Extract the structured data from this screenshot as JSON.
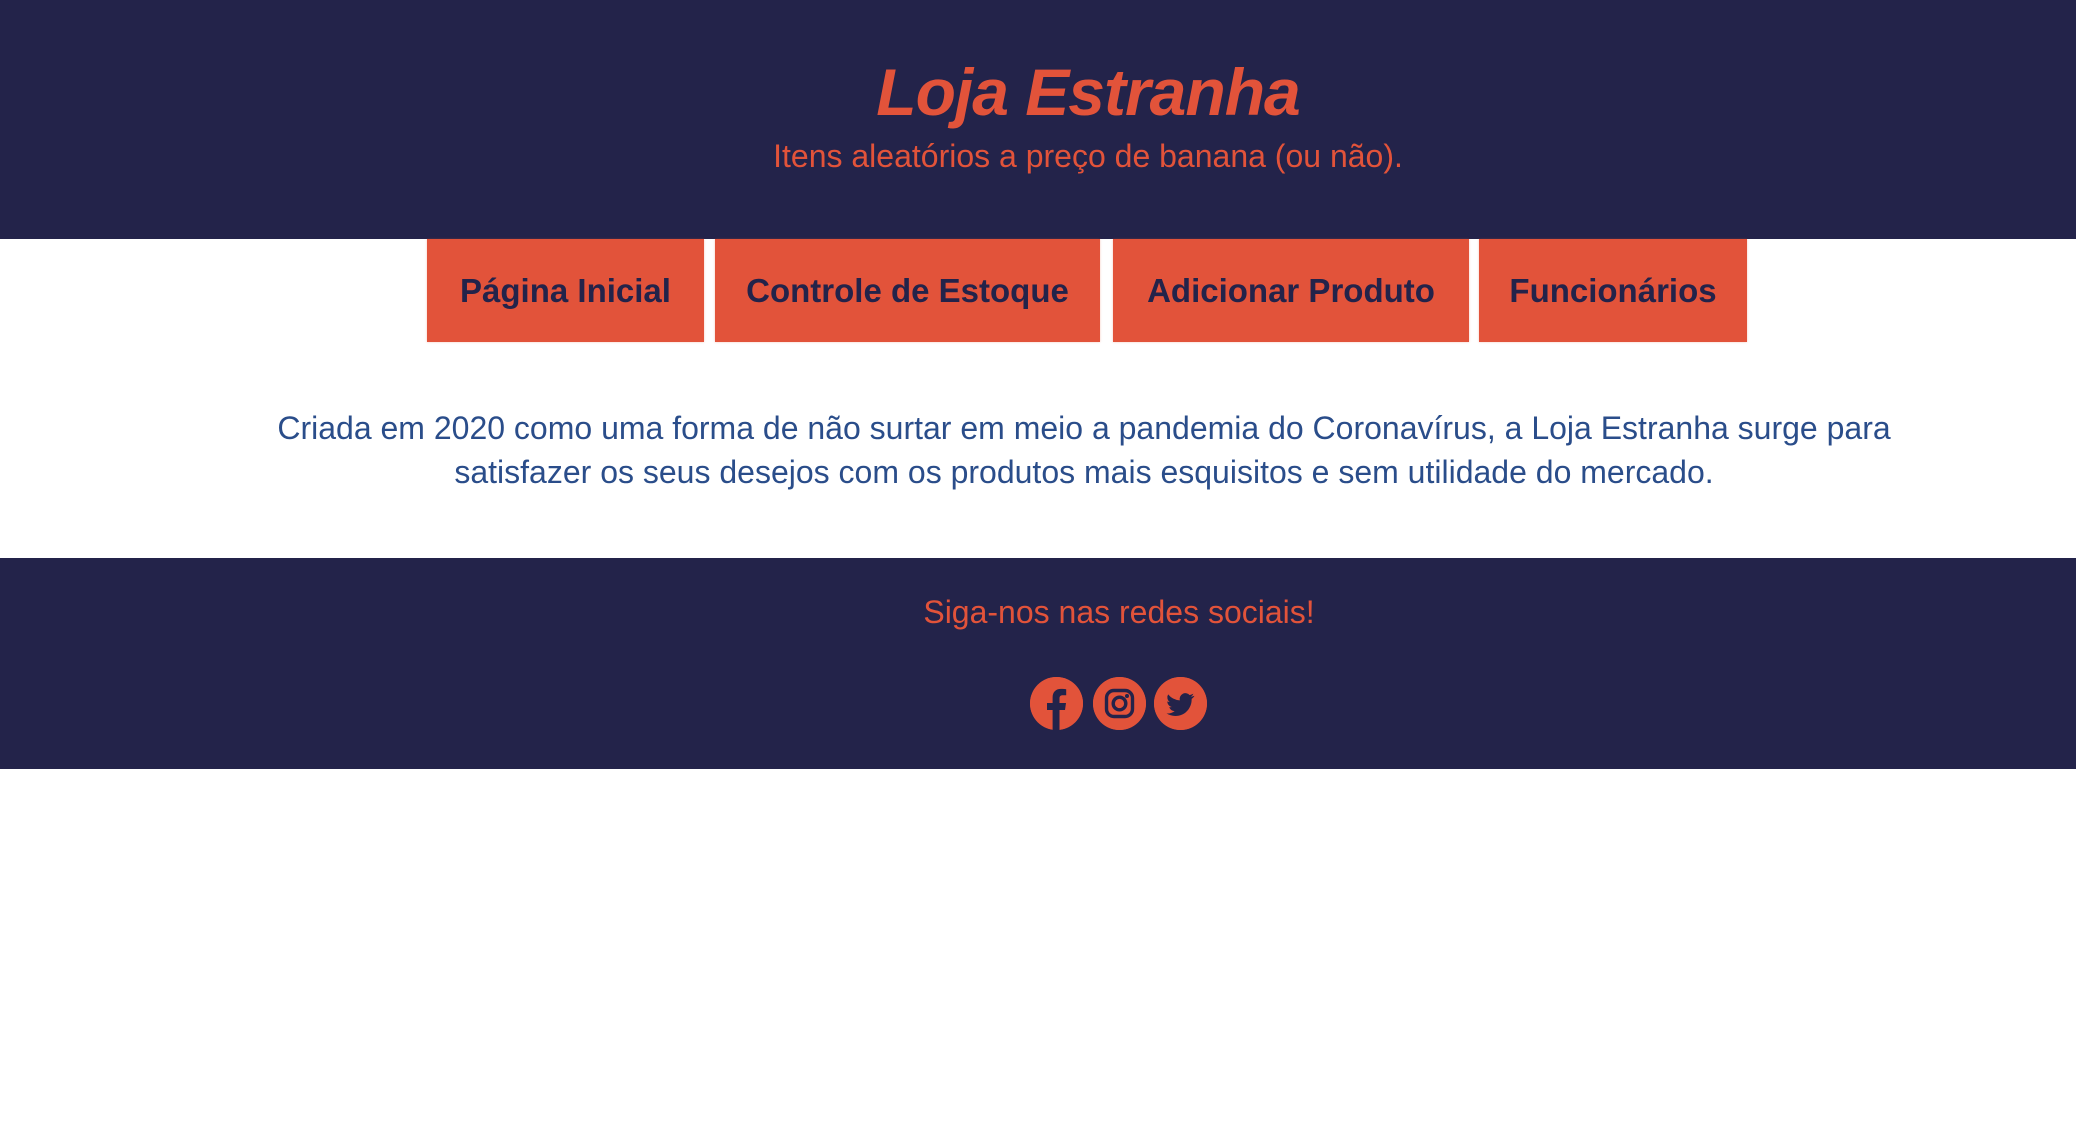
{
  "header": {
    "title": "Loja Estranha",
    "subtitle": "Itens aleatórios a preço de banana (ou não)."
  },
  "nav": {
    "items": [
      {
        "label": "Página Inicial"
      },
      {
        "label": "Controle de Estoque"
      },
      {
        "label": "Adicionar Produto"
      },
      {
        "label": "Funcionários"
      }
    ]
  },
  "intro": {
    "text": "Criada em 2020 como uma forma de não surtar em meio a pandemia do Coronavírus, a Loja Estranha surge para satisfazer os seus desejos com os produtos mais esquisitos e sem utilidade do mercado."
  },
  "footer": {
    "text": "Siga-nos nas redes sociais!",
    "social": [
      {
        "icon": "facebook-icon"
      },
      {
        "icon": "instagram-icon"
      },
      {
        "icon": "twitter-icon"
      }
    ]
  },
  "colors": {
    "dark_navy": "#23234a",
    "accent_red": "#e2533a",
    "text_blue": "#2a4d8a",
    "background": "#ffffff"
  }
}
